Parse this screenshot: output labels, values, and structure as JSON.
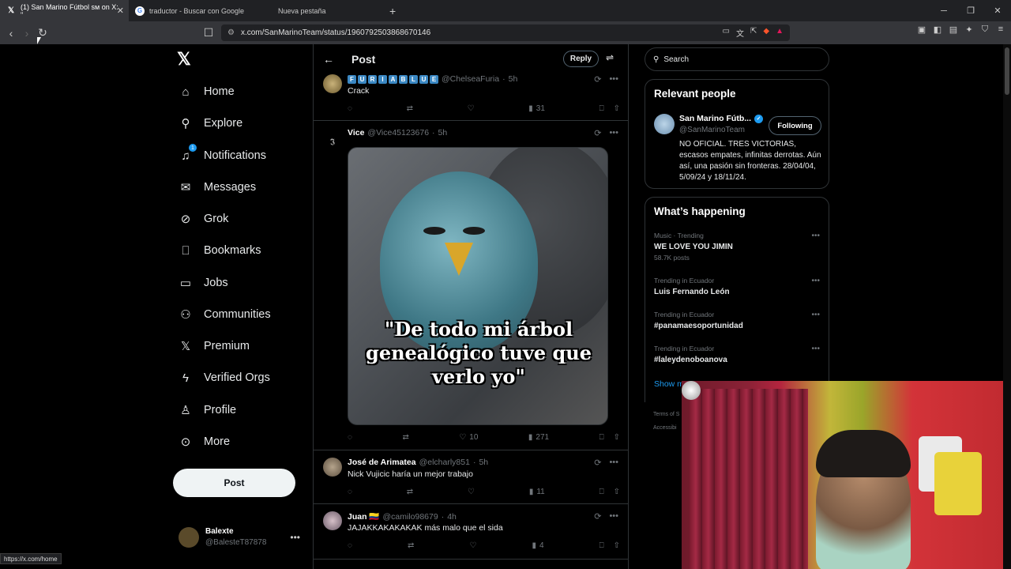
{
  "browser": {
    "tabs": [
      {
        "title": "(1) San Marino Fútbol sм on X: \"",
        "active": true,
        "favicon": "x-icon"
      },
      {
        "title": "traductor - Buscar con Google",
        "active": false,
        "favicon": "google-icon"
      },
      {
        "title": "Nueva pestaña",
        "active": false,
        "favicon": ""
      }
    ],
    "url": "x.com/SanMarinoTeam/status/1960792503868670146",
    "status_link": "https://x.com/home"
  },
  "nav": {
    "items": [
      {
        "label": "Home",
        "icon": "home-icon"
      },
      {
        "label": "Explore",
        "icon": "search-icon"
      },
      {
        "label": "Notifications",
        "icon": "bell-icon",
        "badge": "1"
      },
      {
        "label": "Messages",
        "icon": "mail-icon"
      },
      {
        "label": "Grok",
        "icon": "grok-icon"
      },
      {
        "label": "Bookmarks",
        "icon": "bookmark-icon"
      },
      {
        "label": "Jobs",
        "icon": "briefcase-icon"
      },
      {
        "label": "Communities",
        "icon": "people-icon"
      },
      {
        "label": "Premium",
        "icon": "x-icon"
      },
      {
        "label": "Verified Orgs",
        "icon": "lightning-icon"
      },
      {
        "label": "Profile",
        "icon": "person-icon"
      },
      {
        "label": "More",
        "icon": "more-circle-icon"
      }
    ],
    "post_button": "Post",
    "account": {
      "name": "Balexte",
      "handle": "@BalesteT87878"
    }
  },
  "main": {
    "title": "Post",
    "reply_button": "Reply",
    "replies": [
      {
        "name_letters": [
          "F",
          "U",
          "R",
          "I",
          "A",
          "B",
          "L",
          "U",
          "E"
        ],
        "handle": "@ChelseaFuria",
        "time": "5h",
        "text": "Crack",
        "likes": "",
        "views": "31"
      },
      {
        "name": "Vice",
        "handle": "@Vice45123676",
        "time": "5h",
        "text": "",
        "meme_text": "\"De todo mi árbol genealógico tuve que verlo yo\"",
        "likes": "10",
        "views": "271"
      },
      {
        "name": "José de Arimatea",
        "handle": "@elcharly851",
        "time": "5h",
        "text": "Nick Vujicic haría un mejor trabajo",
        "likes": "",
        "views": "11"
      },
      {
        "name": "Juan 🇨🇴",
        "handle": "@camilo98679",
        "time": "4h",
        "text": "JAJAKKAKAKAKAK más malo que el sida",
        "likes": "",
        "views": "4"
      }
    ]
  },
  "sidebar": {
    "search_placeholder": "Search",
    "relevant": {
      "title": "Relevant people",
      "name": "San Marino Fútb...",
      "handle": "@SanMarinoTeam",
      "follow_label": "Following",
      "bio": "NO OFICIAL. TRES VICTORIAS, escasos empates, infinitas derrotas. Aún así, una pasión sin fronteras. 28/04/04, 5/09/24 y 18/11/24."
    },
    "happening": {
      "title": "What’s happening",
      "trends": [
        {
          "category": "Music · Trending",
          "name": "WE LOVE YOU JIMIN",
          "count": "58.7K posts"
        },
        {
          "category": "Trending in Ecuador",
          "name": "Luis Fernando León",
          "count": ""
        },
        {
          "category": "Trending in Ecuador",
          "name": "#panamaesoportunidad",
          "count": ""
        },
        {
          "category": "Trending in Ecuador",
          "name": "#laleydenoboanova",
          "count": ""
        }
      ],
      "show_more": "Show m"
    },
    "footer": [
      "Terms of S",
      "Accessibi"
    ]
  }
}
